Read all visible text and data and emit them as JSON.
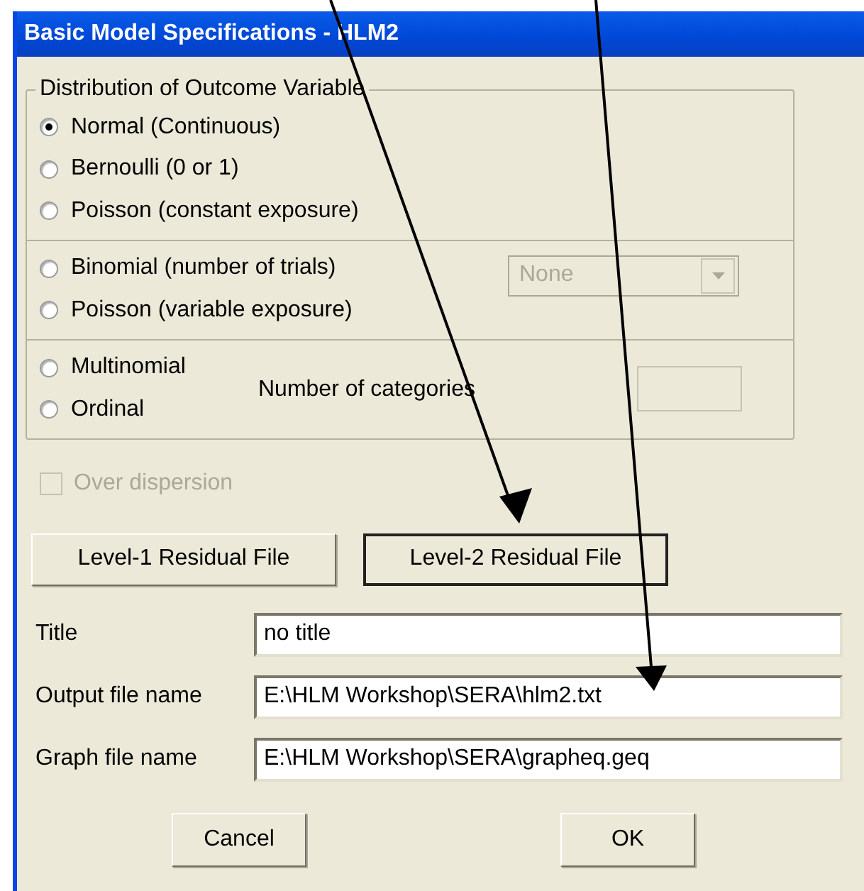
{
  "window": {
    "title": "Basic Model Specifications - HLM2"
  },
  "distribution": {
    "legend": "Distribution of Outcome Variable",
    "sections": [
      {
        "options": [
          {
            "label": "Normal (Continuous)",
            "selected": true
          },
          {
            "label": "Bernoulli  (0 or 1)",
            "selected": false
          },
          {
            "label": "Poisson (constant exposure)",
            "selected": false
          }
        ]
      },
      {
        "options": [
          {
            "label": "Binomial (number of trials)",
            "selected": false
          },
          {
            "label": "Poisson (variable exposure)",
            "selected": false
          }
        ],
        "dropdown": {
          "value": "None",
          "disabled": true
        }
      },
      {
        "options": [
          {
            "label": "Multinomial",
            "selected": false
          },
          {
            "label": "Ordinal",
            "selected": false
          }
        ],
        "categories": {
          "label": "Number of categories",
          "disabled": true
        }
      }
    ]
  },
  "over_dispersion": {
    "label": "Over dispersion",
    "checked": false,
    "disabled": true
  },
  "residual_buttons": [
    {
      "label": "Level-1 Residual File",
      "default": false
    },
    {
      "label": "Level-2 Residual File",
      "default": true
    }
  ],
  "fields": [
    {
      "label": "Title",
      "value": "no title"
    },
    {
      "label": "Output file name",
      "value": "E:\\HLM Workshop\\SERA\\hlm2.txt"
    },
    {
      "label": "Graph file name",
      "value": "E:\\HLM Workshop\\SERA\\grapheq.geq"
    }
  ],
  "buttons": [
    {
      "label": "Cancel"
    },
    {
      "label": "OK"
    }
  ]
}
